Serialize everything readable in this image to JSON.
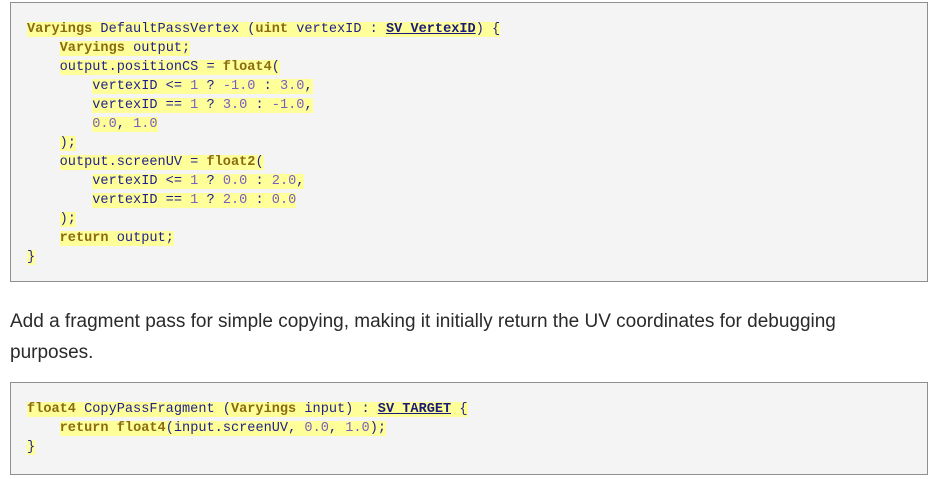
{
  "code_block_1": {
    "lines": [
      [
        {
          "t": "Varyings",
          "c": "kw"
        },
        {
          "t": " DefaultPassVertex (",
          "c": "plain"
        },
        {
          "t": "uint",
          "c": "kw"
        },
        {
          "t": " vertexID : ",
          "c": "plain"
        },
        {
          "t": "SV_VertexID",
          "c": "ty"
        },
        {
          "t": ") {",
          "c": "plain"
        }
      ],
      [
        {
          "t": "    ",
          "c": "ws"
        },
        {
          "t": "Varyings",
          "c": "kw"
        },
        {
          "t": " output;",
          "c": "plain"
        }
      ],
      [
        {
          "t": "    ",
          "c": "ws"
        },
        {
          "t": "output.positionCS = ",
          "c": "plain"
        },
        {
          "t": "float4",
          "c": "kw"
        },
        {
          "t": "(",
          "c": "plain"
        }
      ],
      [
        {
          "t": "        ",
          "c": "ws"
        },
        {
          "t": "vertexID <= ",
          "c": "plain"
        },
        {
          "t": "1",
          "c": "num"
        },
        {
          "t": " ? ",
          "c": "plain"
        },
        {
          "t": "-1.0",
          "c": "num"
        },
        {
          "t": " : ",
          "c": "plain"
        },
        {
          "t": "3.0",
          "c": "num"
        },
        {
          "t": ",",
          "c": "plain"
        }
      ],
      [
        {
          "t": "        ",
          "c": "ws"
        },
        {
          "t": "vertexID == ",
          "c": "plain"
        },
        {
          "t": "1",
          "c": "num"
        },
        {
          "t": " ? ",
          "c": "plain"
        },
        {
          "t": "3.0",
          "c": "num"
        },
        {
          "t": " : ",
          "c": "plain"
        },
        {
          "t": "-1.0",
          "c": "num"
        },
        {
          "t": ",",
          "c": "plain"
        }
      ],
      [
        {
          "t": "        ",
          "c": "ws"
        },
        {
          "t": "0.0",
          "c": "num"
        },
        {
          "t": ", ",
          "c": "plain"
        },
        {
          "t": "1.0",
          "c": "num"
        }
      ],
      [
        {
          "t": "    ",
          "c": "ws"
        },
        {
          "t": ");",
          "c": "plain"
        }
      ],
      [
        {
          "t": "    ",
          "c": "ws"
        },
        {
          "t": "output.screenUV = ",
          "c": "plain"
        },
        {
          "t": "float2",
          "c": "kw"
        },
        {
          "t": "(",
          "c": "plain"
        }
      ],
      [
        {
          "t": "        ",
          "c": "ws"
        },
        {
          "t": "vertexID <= ",
          "c": "plain"
        },
        {
          "t": "1",
          "c": "num"
        },
        {
          "t": " ? ",
          "c": "plain"
        },
        {
          "t": "0.0",
          "c": "num"
        },
        {
          "t": " : ",
          "c": "plain"
        },
        {
          "t": "2.0",
          "c": "num"
        },
        {
          "t": ",",
          "c": "plain"
        }
      ],
      [
        {
          "t": "        ",
          "c": "ws"
        },
        {
          "t": "vertexID == ",
          "c": "plain"
        },
        {
          "t": "1",
          "c": "num"
        },
        {
          "t": " ? ",
          "c": "plain"
        },
        {
          "t": "2.0",
          "c": "num"
        },
        {
          "t": " : ",
          "c": "plain"
        },
        {
          "t": "0.0",
          "c": "num"
        }
      ],
      [
        {
          "t": "    ",
          "c": "ws"
        },
        {
          "t": ");",
          "c": "plain"
        }
      ],
      [
        {
          "t": "    ",
          "c": "ws"
        },
        {
          "t": "return",
          "c": "kw"
        },
        {
          "t": " output;",
          "c": "plain"
        }
      ],
      [
        {
          "t": "}",
          "c": "plain"
        }
      ]
    ]
  },
  "paragraph": "Add a fragment pass for simple copying, making it initially return the UV coordinates for debugging purposes.",
  "code_block_2": {
    "lines": [
      [
        {
          "t": "float4",
          "c": "kw"
        },
        {
          "t": " CopyPassFragment (",
          "c": "plain"
        },
        {
          "t": "Varyings",
          "c": "kw"
        },
        {
          "t": " input) : ",
          "c": "plain"
        },
        {
          "t": "SV_TARGET",
          "c": "ty"
        },
        {
          "t": " {",
          "c": "plain"
        }
      ],
      [
        {
          "t": "    ",
          "c": "ws"
        },
        {
          "t": "return",
          "c": "kw"
        },
        {
          "t": " ",
          "c": "plain"
        },
        {
          "t": "float4",
          "c": "kw"
        },
        {
          "t": "(input.screenUV, ",
          "c": "plain"
        },
        {
          "t": "0.0",
          "c": "num"
        },
        {
          "t": ", ",
          "c": "plain"
        },
        {
          "t": "1.0",
          "c": "num"
        },
        {
          "t": ");",
          "c": "plain"
        }
      ],
      [
        {
          "t": "}",
          "c": "plain"
        }
      ]
    ]
  },
  "colors": {
    "highlight": "#ffff99",
    "keyword": "#8b6b12",
    "number": "#7a5fc0",
    "code_text": "#1f1f8f",
    "code_background": "#f4f4f4",
    "border": "#8f8f8f"
  }
}
